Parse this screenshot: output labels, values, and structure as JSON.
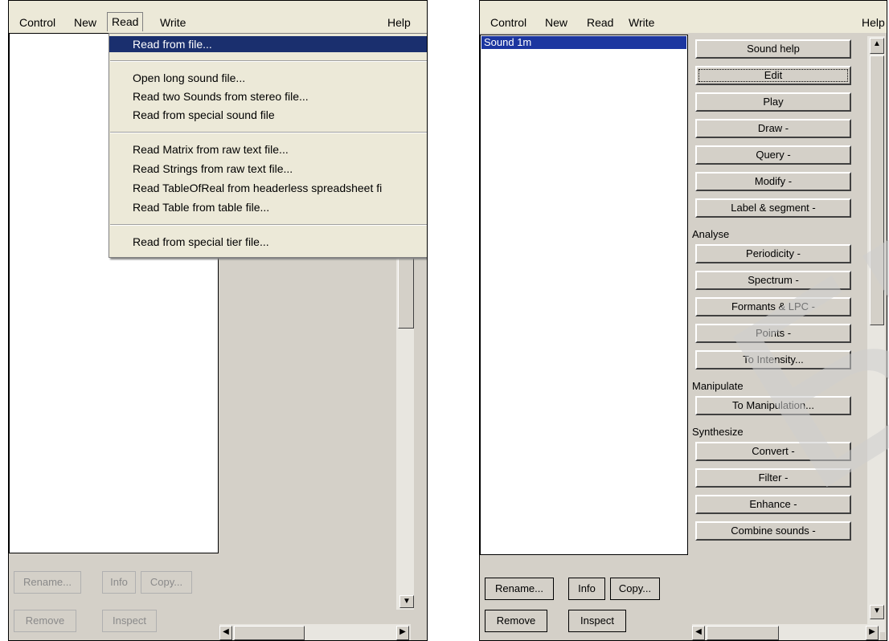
{
  "left_window": {
    "menu": [
      "Control",
      "New",
      "Read",
      "Write",
      "Help"
    ],
    "read_menu": {
      "groups": [
        [
          "Read from file..."
        ],
        [
          "Open long sound file...",
          "Read two Sounds from stereo file...",
          "Read from special sound file"
        ],
        [
          "Read Matrix from raw text file...",
          "Read Strings from raw text file...",
          "Read TableOfReal from headerless spreadsheet fi",
          "Read Table from table file..."
        ],
        [
          "Read from special tier file..."
        ]
      ],
      "highlighted": "Read from file..."
    },
    "bottom_buttons": {
      "rename": "Rename...",
      "info": "Info",
      "copy": "Copy...",
      "remove": "Remove",
      "inspect": "Inspect"
    }
  },
  "right_window": {
    "menu": [
      "Control",
      "New",
      "Read",
      "Write",
      "Help"
    ],
    "objects": [
      "Sound 1m"
    ],
    "actions": [
      {
        "kind": "button",
        "label": "Sound help"
      },
      {
        "kind": "button",
        "label": "Edit",
        "focused": true
      },
      {
        "kind": "button",
        "label": "Play"
      },
      {
        "kind": "button",
        "label": "Draw -"
      },
      {
        "kind": "button",
        "label": "Query -"
      },
      {
        "kind": "button",
        "label": "Modify -"
      },
      {
        "kind": "button",
        "label": "Label & segment -"
      },
      {
        "kind": "section",
        "label": "Analyse"
      },
      {
        "kind": "button",
        "label": "Periodicity -"
      },
      {
        "kind": "button",
        "label": "Spectrum -"
      },
      {
        "kind": "button",
        "label": "Formants & LPC -"
      },
      {
        "kind": "button",
        "label": "Points -"
      },
      {
        "kind": "button",
        "label": "To Intensity..."
      },
      {
        "kind": "section",
        "label": "Manipulate"
      },
      {
        "kind": "button",
        "label": "To Manipulation..."
      },
      {
        "kind": "section",
        "label": "Synthesize"
      },
      {
        "kind": "button",
        "label": "Convert -"
      },
      {
        "kind": "button",
        "label": "Filter -"
      },
      {
        "kind": "button",
        "label": "Enhance -"
      },
      {
        "kind": "button",
        "label": "Combine sounds -"
      }
    ],
    "bottom_buttons": {
      "rename": "Rename...",
      "info": "Info",
      "copy": "Copy...",
      "remove": "Remove",
      "inspect": "Inspect"
    }
  },
  "watermark": "БГУИР",
  "colors": {
    "highlight": "#1a2f6e",
    "selection": "#1c36a0",
    "panel": "#d4d0c8",
    "menubar": "#ece9d8"
  }
}
